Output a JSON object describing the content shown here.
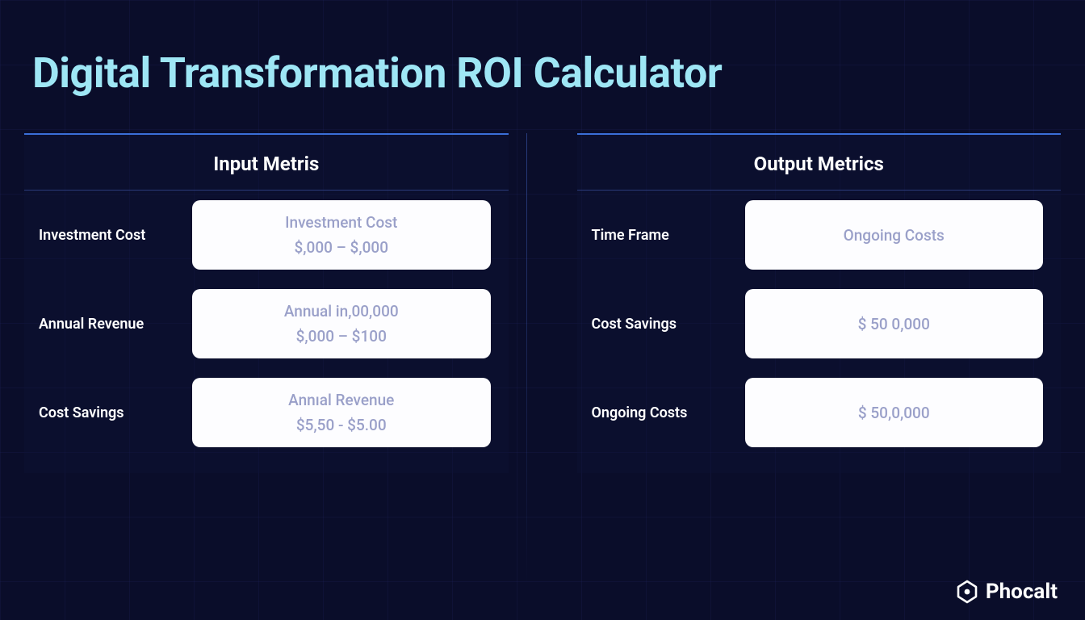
{
  "title": "Digital Transformation ROI Calculator",
  "brand": "Phocalt",
  "inputPanel": {
    "header": "Input Metris",
    "rows": [
      {
        "label": "Investment Cost",
        "line1": "Investment Cost",
        "line2": "$,000  –  $,000"
      },
      {
        "label": "Annual Revenue",
        "line1": "Annual in,00,000",
        "line2": "$,000  –   $100"
      },
      {
        "label": "Cost Savings",
        "line1": "Annıal Revenue",
        "line2": "$5,50 -     $5.00"
      }
    ]
  },
  "outputPanel": {
    "header": "Output Metrics",
    "rows": [
      {
        "label": "Time Frame",
        "line1": "Ongoing Costs",
        "line2": ""
      },
      {
        "label": "Cost Savings",
        "line1": "$ 50 0,000",
        "line2": ""
      },
      {
        "label": "Ongoing Costs",
        "line1": "$ 50,0,000",
        "line2": ""
      }
    ]
  }
}
